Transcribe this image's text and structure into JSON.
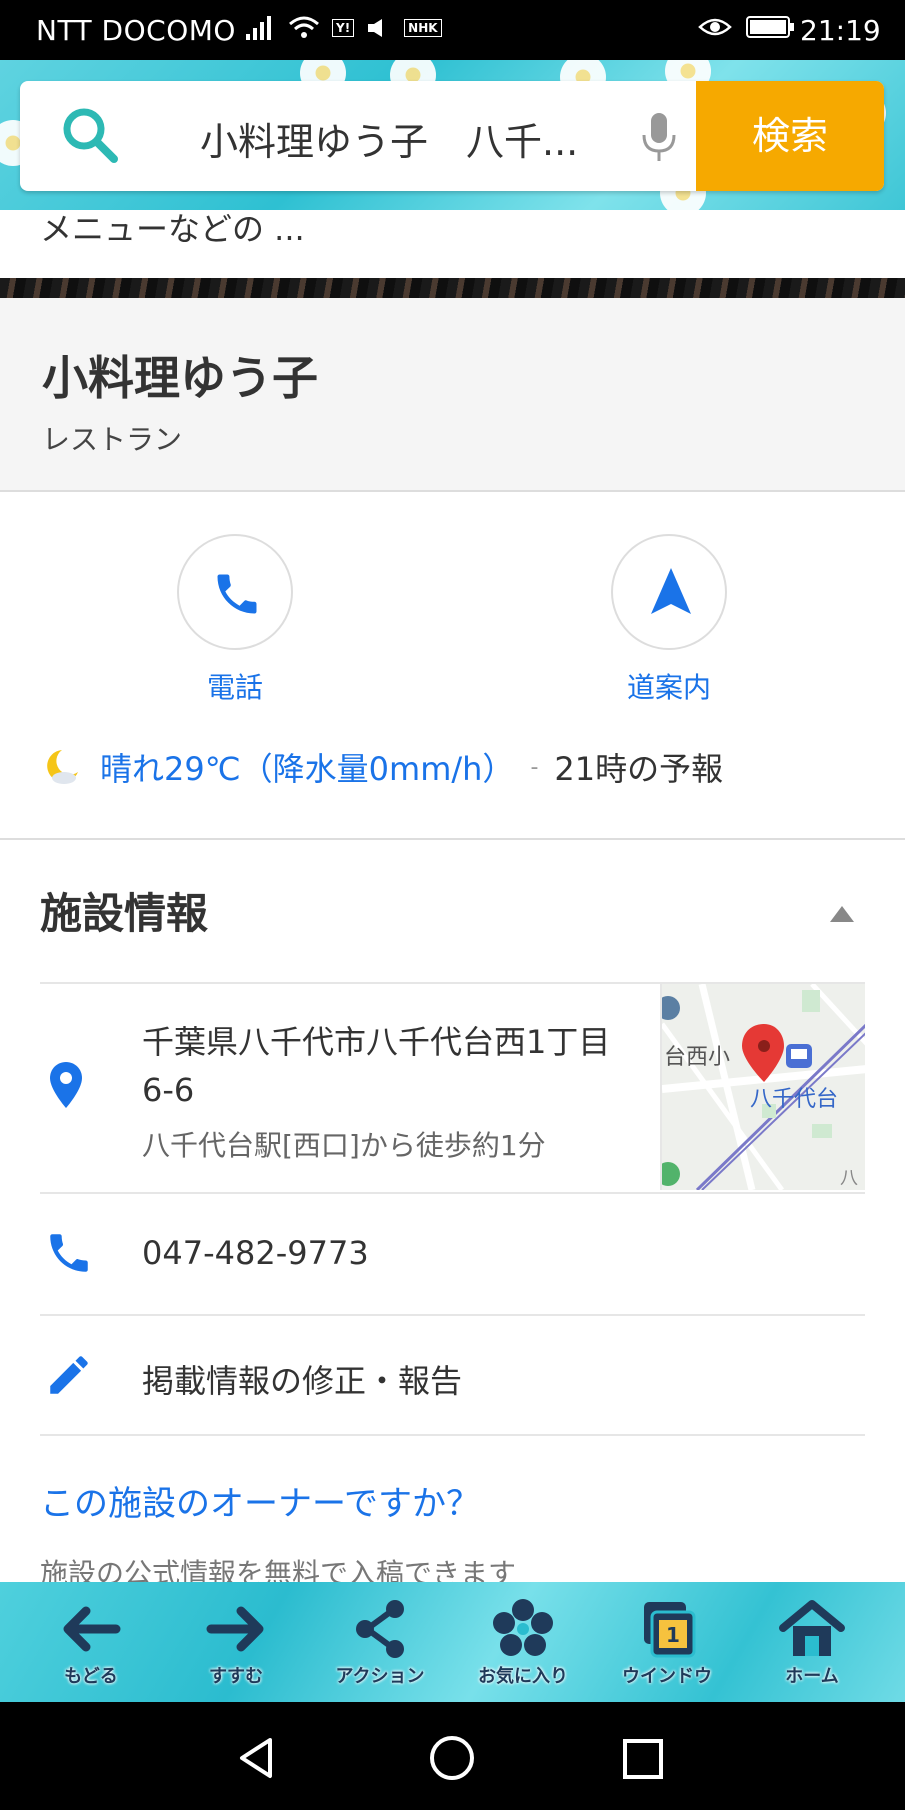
{
  "status_bar": {
    "carrier": "NTT DOCOMO",
    "yahoo_badge": "Y!",
    "nhk_badge": "NHK",
    "time": "21:19"
  },
  "search": {
    "query": "小料理ゆう子　八千...",
    "button_label": "検索"
  },
  "snippet": {
    "text": "メニューなどの ..."
  },
  "place": {
    "name": "小料理ゆう子",
    "category": "レストラン"
  },
  "actions": {
    "call_label": "電話",
    "directions_label": "道案内"
  },
  "weather": {
    "text": "晴れ29℃（降水量0mm/h）",
    "separator": "-",
    "forecast_time": "21時の予報"
  },
  "facility": {
    "heading": "施設情報",
    "address_line": "千葉県八千代市八千代台西1丁目6-6",
    "access": "八千代台駅[西口]から徒歩約1分",
    "phone": "047-482-9773",
    "report": "掲載情報の修正・報告",
    "map_labels": {
      "school": "台西小",
      "station": "八千代台",
      "edge": "八"
    }
  },
  "owner": {
    "link": "この施設のオーナーですか？",
    "subtext": "施設の公式情報を無料で入稿できます"
  },
  "toolbar": {
    "back": "もどる",
    "forward": "すすむ",
    "action": "アクション",
    "favorites": "お気に入り",
    "window": "ウインドウ",
    "window_count": "1",
    "home": "ホーム"
  },
  "colors": {
    "accent": "#1a73e8",
    "search_button": "#f6a900",
    "toolbar_bg": "#2bbccf",
    "map_pin": "#e53935"
  }
}
